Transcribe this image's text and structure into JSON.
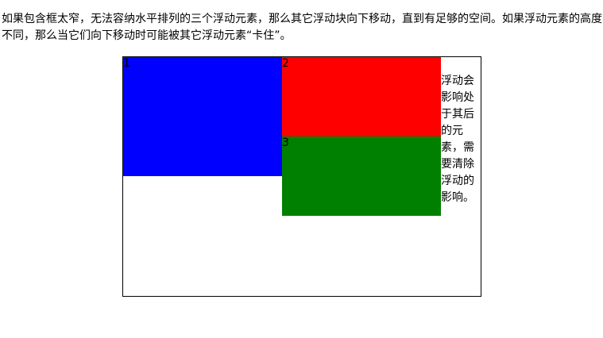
{
  "intro_text": "如果包含框太窄，无法容纳水平排列的三个浮动元素，那么其它浮动块向下移动，直到有足够的空间。如果浮动元素的高度不同，那么当它们向下移动时可能被其它浮动元素“卡住”。",
  "boxes": [
    {
      "label": "1",
      "color": "#0000ff"
    },
    {
      "label": "2",
      "color": "#ff0000"
    },
    {
      "label": "3",
      "color": "#008000"
    }
  ],
  "side_text": "浮动会影响处于其后的元素，需要清除浮动的影响。"
}
